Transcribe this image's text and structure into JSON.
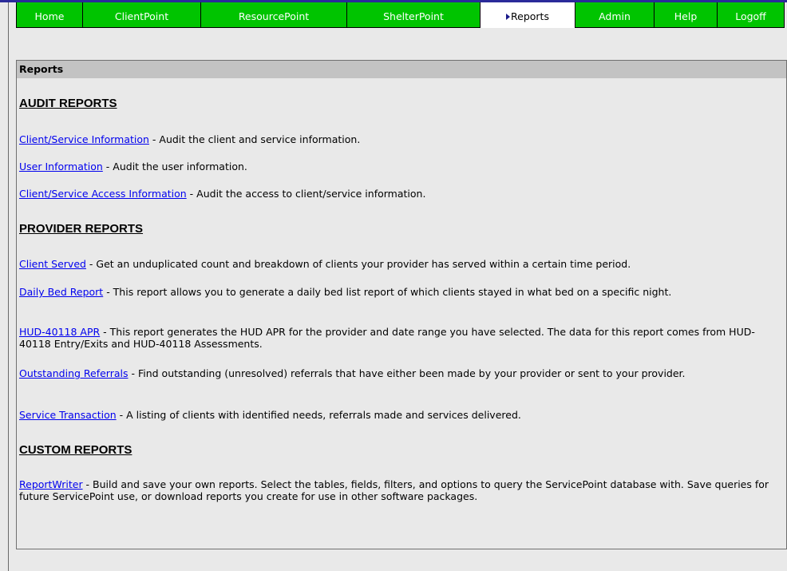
{
  "nav": {
    "tabs": [
      {
        "label": "Home",
        "active": false
      },
      {
        "label": "ClientPoint",
        "active": false
      },
      {
        "label": "ResourcePoint",
        "active": false
      },
      {
        "label": "ShelterPoint",
        "active": false
      },
      {
        "label": "Reports",
        "active": true
      },
      {
        "label": "Admin",
        "active": false
      },
      {
        "label": "Help",
        "active": false
      },
      {
        "label": "Logoff",
        "active": false
      }
    ]
  },
  "panel": {
    "title": "Reports"
  },
  "sections": {
    "audit": {
      "title": "AUDIT REPORTS",
      "items": [
        {
          "link": "Client/Service Information",
          "desc": " - Audit the client and service information."
        },
        {
          "link": "User Information",
          "desc": " - Audit the user information."
        },
        {
          "link": "Client/Service Access Information",
          "desc": " - Audit the access to client/service information."
        }
      ]
    },
    "provider": {
      "title": "PROVIDER REPORTS",
      "items": [
        {
          "link": "Client Served",
          "desc": " - Get an unduplicated count and breakdown of clients your provider has served within a certain time period."
        },
        {
          "link": "Daily Bed Report",
          "desc": " - This report allows you to generate a daily bed list report of which clients stayed in what bed on a specific night."
        },
        {
          "link": "HUD-40118 APR",
          "desc": " - This report generates the HUD APR for the provider and date range you have selected. The data for this report comes from HUD-40118 Entry/Exits and HUD-40118 Assessments."
        },
        {
          "link": "Outstanding Referrals",
          "desc": " - Find outstanding (unresolved) referrals that have either been made by your provider or sent to your provider."
        },
        {
          "link": "Service Transaction",
          "desc": " - A listing of clients with identified needs, referrals made and services delivered."
        }
      ]
    },
    "custom": {
      "title": "CUSTOM REPORTS",
      "items": [
        {
          "link": "ReportWriter",
          "desc": " - Build and save your own reports. Select the tables, fields, filters, and options to query the ServicePoint database with. Save queries for future ServicePoint use, or download reports you create for use in other software packages."
        }
      ]
    }
  },
  "colors": {
    "tab_bg": "#00c400",
    "tab_active_bg": "#ffffff",
    "link": "#0000ee",
    "header_bg": "#c3c3c3",
    "top_border": "#2a2a9a"
  }
}
